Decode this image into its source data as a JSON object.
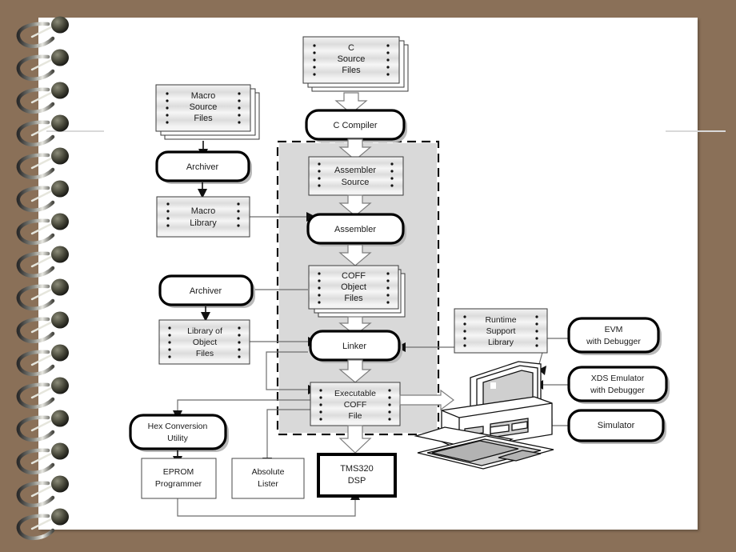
{
  "page": {
    "background_color": "#8a7058",
    "paper_color": "#ffffff",
    "binding": "spiral-wire-binding"
  },
  "diagram": {
    "title": "TMS320 DSP software development flow",
    "shaded_region_label": "",
    "nodes": [
      {
        "id": "c-source-files",
        "label": "C\nSource\nFiles",
        "lines": [
          "C",
          "Source",
          "Files"
        ],
        "type": "file-stack"
      },
      {
        "id": "macro-source-files",
        "label": "Macro\nSource\nFiles",
        "lines": [
          "Macro",
          "Source",
          "Files"
        ],
        "type": "file-stack"
      },
      {
        "id": "c-compiler",
        "label": "C Compiler",
        "lines": [
          "C Compiler"
        ],
        "type": "process"
      },
      {
        "id": "archiver-top",
        "label": "Archiver",
        "lines": [
          "Archiver"
        ],
        "type": "process"
      },
      {
        "id": "macro-library",
        "label": "Macro\nLibrary",
        "lines": [
          "Macro",
          "Library"
        ],
        "type": "file"
      },
      {
        "id": "assembler-source",
        "label": "Assembler\nSource",
        "lines": [
          "Assembler",
          "Source"
        ],
        "type": "file"
      },
      {
        "id": "assembler",
        "label": "Assembler",
        "lines": [
          "Assembler"
        ],
        "type": "process"
      },
      {
        "id": "coff-object-files",
        "label": "COFF\nObject\nFiles",
        "lines": [
          "COFF",
          "Object",
          "Files"
        ],
        "type": "file-stack"
      },
      {
        "id": "archiver-bottom",
        "label": "Archiver",
        "lines": [
          "Archiver"
        ],
        "type": "process"
      },
      {
        "id": "library-of-object-files",
        "label": "Library of\nObject\nFiles",
        "lines": [
          "Library of",
          "Object",
          "Files"
        ],
        "type": "file"
      },
      {
        "id": "linker",
        "label": "Linker",
        "lines": [
          "Linker"
        ],
        "type": "process"
      },
      {
        "id": "runtime-support-library",
        "label": "Runtime\nSupport\nLibrary",
        "lines": [
          "Runtime",
          "Support",
          "Library"
        ],
        "type": "file"
      },
      {
        "id": "executable-coff-file",
        "label": "Executable\nCOFF\nFile",
        "lines": [
          "Executable",
          "COFF",
          "File"
        ],
        "type": "file"
      },
      {
        "id": "hex-conversion-utility",
        "label": "Hex Conversion\nUtility",
        "lines": [
          "Hex Conversion",
          "Utility"
        ],
        "type": "process"
      },
      {
        "id": "eprom-programmer",
        "label": "EPROM\nProgrammer",
        "lines": [
          "EPROM",
          "Programmer"
        ],
        "type": "plain"
      },
      {
        "id": "absolute-lister",
        "label": "Absolute\nLister",
        "lines": [
          "Absolute",
          "Lister"
        ],
        "type": "plain"
      },
      {
        "id": "tms320-dsp",
        "label": "TMS320\nDSP",
        "lines": [
          "TMS320",
          "DSP"
        ],
        "type": "target"
      },
      {
        "id": "evm-with-debugger",
        "label": "EVM\nwith Debugger",
        "lines": [
          "EVM",
          "with Debugger"
        ],
        "type": "process"
      },
      {
        "id": "xds-emulator-with-debugger",
        "label": "XDS Emulator\nwith Debugger",
        "lines": [
          "XDS Emulator",
          "with Debugger"
        ],
        "type": "process"
      },
      {
        "id": "simulator",
        "label": "Simulator",
        "lines": [
          "Simulator"
        ],
        "type": "process"
      },
      {
        "id": "host-computer",
        "label": "",
        "lines": [],
        "type": "illustration"
      }
    ],
    "edges": [
      {
        "from": "c-source-files",
        "to": "c-compiler"
      },
      {
        "from": "c-compiler",
        "to": "assembler-source"
      },
      {
        "from": "macro-source-files",
        "to": "archiver-top"
      },
      {
        "from": "archiver-top",
        "to": "macro-library"
      },
      {
        "from": "macro-library",
        "to": "assembler"
      },
      {
        "from": "assembler-source",
        "to": "assembler"
      },
      {
        "from": "assembler",
        "to": "coff-object-files"
      },
      {
        "from": "coff-object-files",
        "to": "archiver-bottom"
      },
      {
        "from": "coff-object-files",
        "to": "linker"
      },
      {
        "from": "archiver-bottom",
        "to": "library-of-object-files"
      },
      {
        "from": "library-of-object-files",
        "to": "linker"
      },
      {
        "from": "runtime-support-library",
        "to": "linker"
      },
      {
        "from": "linker",
        "to": "executable-coff-file"
      },
      {
        "from": "executable-coff-file",
        "to": "host-computer"
      },
      {
        "from": "executable-coff-file",
        "to": "hex-conversion-utility"
      },
      {
        "from": "executable-coff-file",
        "to": "absolute-lister"
      },
      {
        "from": "executable-coff-file",
        "to": "tms320-dsp"
      },
      {
        "from": "hex-conversion-utility",
        "to": "eprom-programmer"
      },
      {
        "from": "eprom-programmer",
        "to": "tms320-dsp"
      },
      {
        "from": "evm-with-debugger",
        "to": "host-computer"
      },
      {
        "from": "xds-emulator-with-debugger",
        "to": "host-computer"
      },
      {
        "from": "simulator",
        "to": "host-computer"
      }
    ],
    "colors": {
      "file_fill": "#e8e8e8",
      "process_stroke": "#000000",
      "connector": "#6e6e6e",
      "shaded_region": "#d9d9d9",
      "dashed_region_stroke": "#111111"
    }
  }
}
